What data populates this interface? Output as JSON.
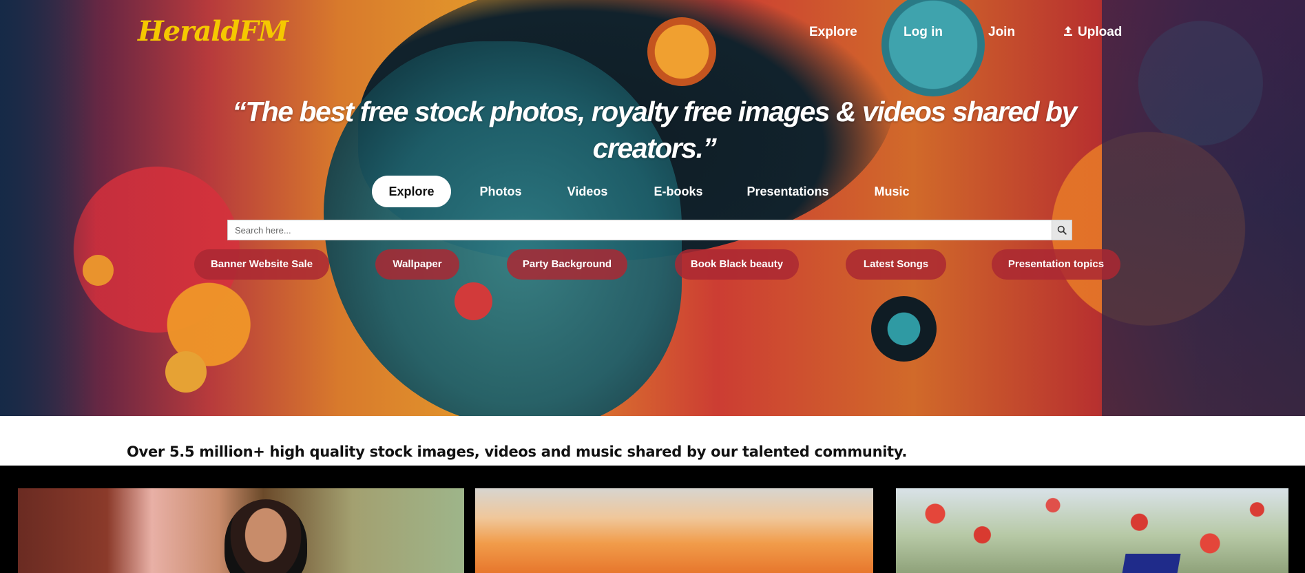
{
  "brand": {
    "logo": "HeraldFM",
    "logo_color": "#f5c800"
  },
  "topnav": {
    "explore": "Explore",
    "login": "Log in",
    "join": "Join",
    "upload": "Upload",
    "upload_icon": "upload-icon"
  },
  "hero": {
    "headline": "“The best free stock photos, royalty free images & videos shared by creators.”",
    "tabs": [
      {
        "label": "Explore",
        "active": true
      },
      {
        "label": "Photos",
        "active": false
      },
      {
        "label": "Videos",
        "active": false
      },
      {
        "label": "E-books",
        "active": false
      },
      {
        "label": "Presentations",
        "active": false
      },
      {
        "label": "Music",
        "active": false
      }
    ],
    "search": {
      "placeholder": "Search here...",
      "value": "",
      "icon": "search-icon"
    },
    "chips": [
      "Banner Website Sale",
      "Wallpaper",
      "Party Background",
      "Book Black beauty",
      "Latest Songs",
      "Presentation topics"
    ],
    "chip_color": "#a8283290"
  },
  "main": {
    "tagline": "Over 5.5 million+ high quality stock images, videos and music shared by our talented community."
  }
}
